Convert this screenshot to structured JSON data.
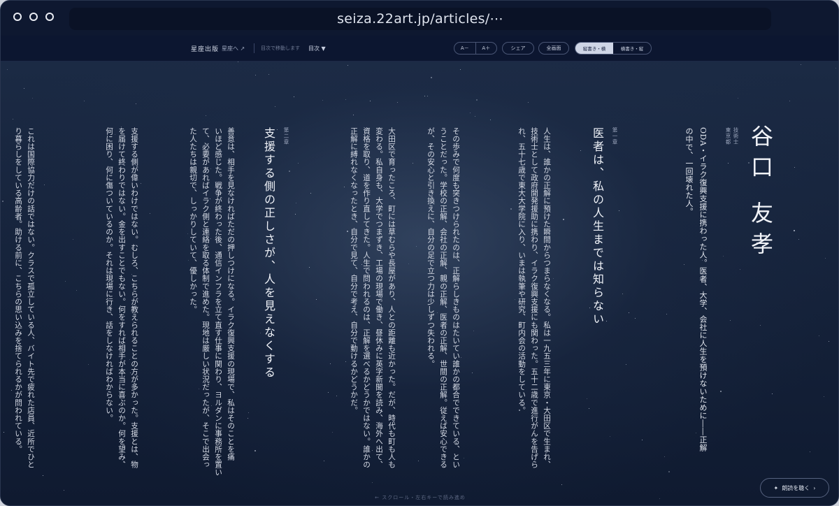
{
  "browser": {
    "url": "seiza.22art.jp/articles/⋯"
  },
  "toolbar": {
    "brand": "星座出版",
    "home_link": "星座へ ↗",
    "hint": "目次で移動します",
    "toc": "目次 ▼",
    "font_smaller": "A－",
    "font_larger": "A＋",
    "share": "シェア",
    "fullscreen": "全画面",
    "mode_vertical": "縦書き・横",
    "mode_horizontal": "横書き・縦"
  },
  "article": {
    "author_name_1": "谷口",
    "author_name_2": "友孝",
    "author_affiliation": "東京都",
    "author_role": "技術士",
    "lead_lines": [
      "ODA・イラク復興支援に携わった人。医者、大学、会社に人生を預けないために――正解",
      "の中で、一回壊れた人。"
    ],
    "chapter1_label": "第一章",
    "chapter1_title": "医者は、私の人生までは知らない",
    "chapter1_paragraphs": [
      [
        "人生は、誰かの正解に預けた瞬間からつまらなくなる。私は一九五三年に東京・大田区で生まれ、",
        "技術士として政府開発援助に携わり、イラク復興支援にも関わった。五十二歳で進行がんを告げら",
        "れ、五十七歳で東大大学院に入り、いまは執筆や研究、町内会の活動をしている。"
      ],
      [
        "その歩みで何度も突きつけられたのは、正解らしきものはたいてい誰かの都合でできている、とい",
        "うことだった。学校の正解、会社の正解、親の正解、医者の正解、世間の正解。従えば安心できる",
        "が、その安心と引き換えに、自分の足で立つ力は少しずつ失われる。"
      ],
      [
        "大田区で育ったころ、町には草むらや長屋があり、人との距離も近かった。だが、時代も町も人も",
        "変わる。私自身も、大学でつまずき、工場の現場で働き、昼休みに英字新聞を読み、海外へ出て、",
        "資格を取り、道を作り直してきた。人生で問われるのは、正解を選べるかどうかではない。誰かの",
        "正解に縛れなくなったとき、自分で見て、自分で考え、自分で動けるかどうかだ。"
      ]
    ],
    "chapter2_label": "第二章",
    "chapter2_title": "支援する側の正しさが、人を見えなくする",
    "chapter2_paragraphs": [
      [
        "善意は、相手を見なければただの押しつけになる。イラク復興支援の現場で、私はそのことを痛",
        "いほど感じた。戦争が終わった後、通信インフラを立て直す仕事に関わり、ヨルダンに事務所を置い",
        "て、必要があればイラク側と連絡を取る体制で進めた。現地は厳しい状況だったが、そこで出会っ",
        "た人たちは親切で、しっかりしていて、優しかった。"
      ],
      [
        "支援する側が偉いわけではない。むしろ、こちらが教えられることの方が多かった。支援とは、物",
        "を届けて終わりではない。金を出すことでもない。何をすれば相手が本当に喜ぶのか。何を望み、",
        "何に困り、何に傷ついているのか。それは現場に行き、話をしなければわからない。"
      ],
      [
        "これは国際協力だけの話ではない。クラスで孤立している人、バイト先で疲れた店員、近所でひと",
        "り暮らしをしている高齢者。助ける前に、こちらの思い込みを捨てられるかが問われている。"
      ]
    ]
  },
  "footer": {
    "scroll_hint": "← スクロール・左右キーで読み進め",
    "listen_label": "朗読を聴く",
    "listen_arrow": "›"
  }
}
